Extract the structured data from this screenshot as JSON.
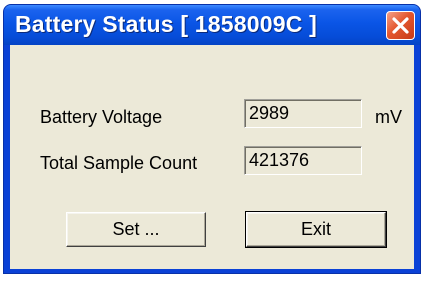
{
  "window": {
    "title": "Battery Status [ 1858009C ]"
  },
  "fields": [
    {
      "label": "Battery Voltage",
      "value": "2989",
      "unit": "mV"
    },
    {
      "label": "Total Sample Count",
      "value": "421376"
    }
  ],
  "buttons": {
    "set_label": "Set ...",
    "exit_label": "Exit"
  },
  "icons": {
    "close": "close-icon"
  },
  "colors": {
    "titlebar": "#0a55e6",
    "close_button": "#e4572f",
    "dialog_face": "#ece9d8"
  }
}
